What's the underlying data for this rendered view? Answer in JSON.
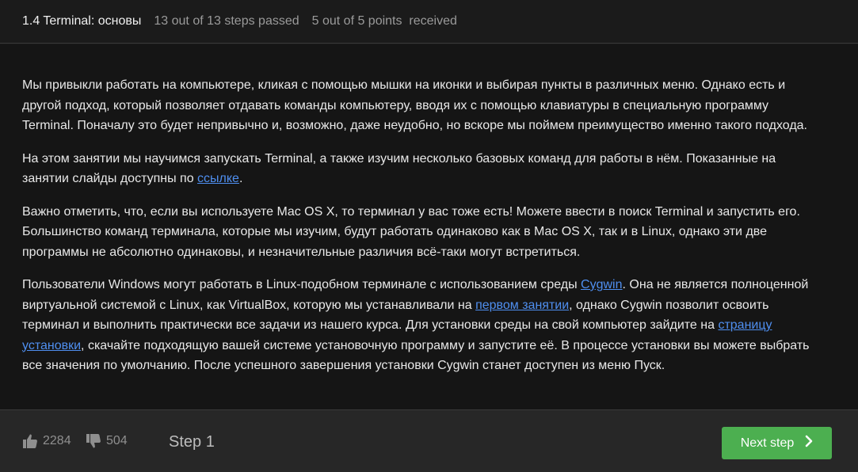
{
  "header": {
    "title": "1.4 Terminal: основы",
    "steps_passed": "13 out of 13 steps passed",
    "points_received": "5 out of 5 points  received"
  },
  "content": {
    "p1": "Мы привыкли работать на компьютере, кликая с помощью мышки на иконки и выбирая пункты в различных меню. Однако есть и другой подход, который позволяет отдавать команды компьютеру, вводя их с помощью клавиатуры в специальную программу Terminal. Поначалу это будет непривычно и, возможно, даже неудобно, но вскоре мы поймем преимущество именно такого подхода.",
    "p2_before": "На этом занятии мы научимся запускать Terminal, а также изучим несколько базовых команд для работы в нём. Показанные на занятии слайды доступны по ",
    "p2_link": "ссылке",
    "p2_after": ".",
    "p3": "Важно отметить, что, если вы используете Mac OS X, то терминал у вас тоже есть! Можете ввести в поиск Terminal и запустить его. Большинство команд терминала, которые мы изучим, будут работать одинаково как в Mac OS X, так и в Linux, однако эти две программы не абсолютно одинаковы, и незначительные различия всё-таки могут встретиться.",
    "p4_a": "Пользователи Windows могут работать в Linux-подобном терминале с использованием среды ",
    "p4_link1": "Cygwin",
    "p4_b": ". Она не является полноценной виртуальной системой с Linux, как VirtualBox, которую мы устанавливали на ",
    "p4_link2": "первом занятии",
    "p4_c": ", однако Cygwin позволит освоить терминал и выполнить практически все задачи из нашего курса. Для установки среды на свой компьютер зайдите на ",
    "p4_link3": "страницу установки",
    "p4_d": ", скачайте подходящую вашей системе установочную программу и запустите её. В процессе установки вы можете выбрать все значения по умолчанию. После успешного завершения установки Cygwin станет доступен из меню Пуск."
  },
  "footer": {
    "likes": "2284",
    "dislikes": "504",
    "step_label": "Step 1",
    "next_label": "Next step",
    "like_icon": "thumbs-up-icon",
    "dislike_icon": "thumbs-down-icon",
    "next_icon": "chevron-right-icon"
  },
  "colors": {
    "accent": "#4caf50",
    "link": "#4f8ff0",
    "background": "#151515"
  }
}
